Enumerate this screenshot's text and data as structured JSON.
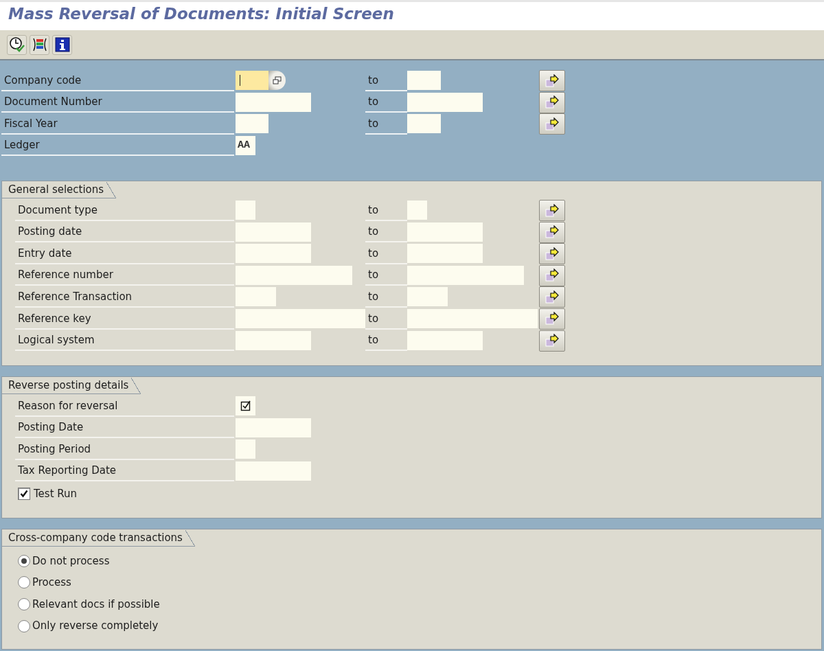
{
  "window": {
    "title": "Mass Reversal of Documents: Initial Screen"
  },
  "selection": {
    "rows": [
      {
        "label": "Company code",
        "focused": true,
        "to_label": "to"
      },
      {
        "label": "Document Number",
        "focused": false,
        "to_label": "to"
      },
      {
        "label": "Fiscal Year",
        "focused": false,
        "to_label": "to"
      },
      {
        "label": "Ledger",
        "focused": false,
        "value": "AA"
      }
    ]
  },
  "general_selections": {
    "title": "General selections",
    "rows": [
      {
        "label": "Document type",
        "to_label": "to"
      },
      {
        "label": "Posting date",
        "to_label": "to"
      },
      {
        "label": "Entry date",
        "to_label": "to"
      },
      {
        "label": "Reference number",
        "to_label": "to"
      },
      {
        "label": "Reference Transaction",
        "to_label": "to"
      },
      {
        "label": "Reference key",
        "to_label": "to"
      },
      {
        "label": "Logical system",
        "to_label": "to"
      }
    ]
  },
  "reverse_posting_details": {
    "title": "Reverse posting details",
    "rows": [
      {
        "kind": "required",
        "label": "Reason for reversal"
      },
      {
        "kind": "field",
        "label": "Posting Date"
      },
      {
        "kind": "field",
        "label": "Posting Period"
      },
      {
        "kind": "field",
        "label": "Tax Reporting Date"
      },
      {
        "kind": "checkbox",
        "label": "Test Run",
        "checked": true
      }
    ]
  },
  "cross_company_code_transactions": {
    "title": "Cross-company code transactions",
    "options": [
      {
        "label": "Do not process",
        "selected": true
      },
      {
        "label": "Process",
        "selected": false
      },
      {
        "label": "Relevant docs if possible",
        "selected": false
      },
      {
        "label": "Only reverse completely",
        "selected": false
      }
    ]
  }
}
